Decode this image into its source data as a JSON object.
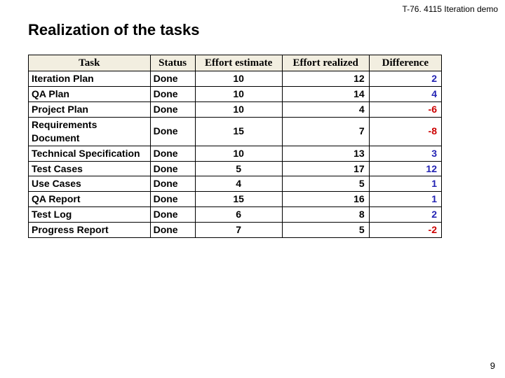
{
  "header": "T-76. 4115 Iteration demo",
  "title": "Realization of the tasks",
  "columns": {
    "task": "Task",
    "status": "Status",
    "estimate": "Effort estimate",
    "realized": "Effort realized",
    "difference": "Difference"
  },
  "rows": [
    {
      "task": "Iteration Plan",
      "status": "Done",
      "estimate": "10",
      "realized": "12",
      "difference": "2",
      "diff_sign": "pos"
    },
    {
      "task": "QA Plan",
      "status": "Done",
      "estimate": "10",
      "realized": "14",
      "difference": "4",
      "diff_sign": "pos"
    },
    {
      "task": "Project Plan",
      "status": "Done",
      "estimate": "10",
      "realized": "4",
      "difference": "-6",
      "diff_sign": "neg"
    },
    {
      "task": "Requirements Document",
      "status": "Done",
      "estimate": "15",
      "realized": "7",
      "difference": "-8",
      "diff_sign": "neg"
    },
    {
      "task": "Technical Specification",
      "status": "Done",
      "estimate": "10",
      "realized": "13",
      "difference": "3",
      "diff_sign": "pos"
    },
    {
      "task": "Test Cases",
      "status": "Done",
      "estimate": "5",
      "realized": "17",
      "difference": "12",
      "diff_sign": "pos"
    },
    {
      "task": "Use Cases",
      "status": "Done",
      "estimate": "4",
      "realized": "5",
      "difference": "1",
      "diff_sign": "pos"
    },
    {
      "task": "QA Report",
      "status": "Done",
      "estimate": "15",
      "realized": "16",
      "difference": "1",
      "diff_sign": "pos"
    },
    {
      "task": "Test Log",
      "status": "Done",
      "estimate": "6",
      "realized": "8",
      "difference": "2",
      "diff_sign": "pos"
    },
    {
      "task": "Progress Report",
      "status": "Done",
      "estimate": "7",
      "realized": "5",
      "difference": "-2",
      "diff_sign": "neg"
    }
  ],
  "page_number": "9",
  "chart_data": {
    "type": "table",
    "columns": [
      "Task",
      "Status",
      "Effort estimate",
      "Effort realized",
      "Difference"
    ],
    "rows": [
      [
        "Iteration Plan",
        "Done",
        10,
        12,
        2
      ],
      [
        "QA Plan",
        "Done",
        10,
        14,
        4
      ],
      [
        "Project Plan",
        "Done",
        10,
        4,
        -6
      ],
      [
        "Requirements Document",
        "Done",
        15,
        7,
        -8
      ],
      [
        "Technical Specification",
        "Done",
        10,
        13,
        3
      ],
      [
        "Test Cases",
        "Done",
        5,
        17,
        12
      ],
      [
        "Use Cases",
        "Done",
        4,
        5,
        1
      ],
      [
        "QA Report",
        "Done",
        15,
        16,
        1
      ],
      [
        "Test Log",
        "Done",
        6,
        8,
        2
      ],
      [
        "Progress Report",
        "Done",
        7,
        5,
        -2
      ]
    ]
  }
}
